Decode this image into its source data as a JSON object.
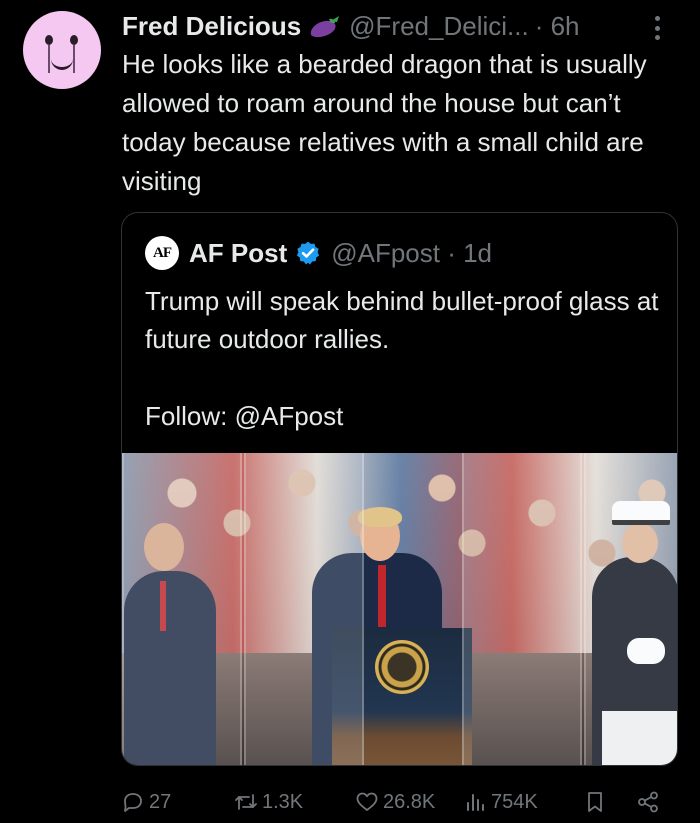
{
  "tweet": {
    "author_name": "Fred Delicious",
    "author_emoji": "eggplant-emoji",
    "handle": "@Fred_Delici...",
    "time": "· 6h",
    "text": "He looks like a bearded dragon that is usually allowed to roam around the house but can’t today because relatives with a small child are visiting"
  },
  "quote": {
    "logo_text": "AF",
    "author_name": "AF Post",
    "handle": "@AFpost · 1d",
    "text": "Trump will speak behind bullet-proof glass at future outdoor rallies.",
    "follow": "Follow: @AFpost"
  },
  "actions": {
    "reply_count": "27",
    "repost_count": "1.3K",
    "like_count": "26.8K",
    "view_count": "754K"
  },
  "colors": {
    "background": "#000000",
    "text": "#e7e9ea",
    "muted": "#71767b",
    "verified": "#1d9bf0",
    "avatar": "#f5c8f2"
  }
}
